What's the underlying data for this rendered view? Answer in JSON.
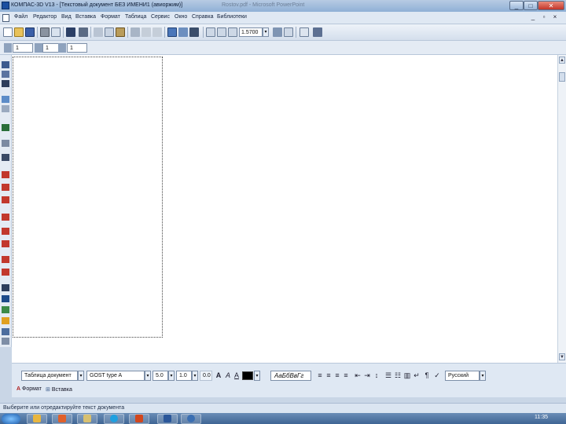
{
  "window": {
    "title": "КОМПАС-3D V13 - [Текстовый документ БЕЗ ИМЕНИ1 (авиоржим)]",
    "title_dim": "Rostov.pdf - Microsoft PowerPoint",
    "controls": [
      "_",
      "□",
      "✕"
    ]
  },
  "menu": {
    "items": [
      "Файл",
      "Редактор",
      "Вид",
      "Вставка",
      "Формат",
      "Таблица",
      "Сервис",
      "Окно",
      "Справка",
      "Библиотеки"
    ]
  },
  "toolbar": {
    "zoom_value": "1.5700",
    "zoom_arrow": "▾"
  },
  "toolbar2": {
    "field1": "1",
    "field2": "1",
    "field3": "1"
  },
  "format_panel": {
    "style_value": "Таблица документ",
    "font_value": "GOST type A",
    "size_value": "5.0",
    "scale_value": "1.0",
    "spacing_value": "0.0",
    "bold_glyph": "A",
    "italic_glyph": "A",
    "underline_glyph": "A",
    "sample_text": "АаБбВвГг",
    "language_value": "Русский",
    "tabs": [
      "Формат",
      "Вставка"
    ],
    "arrow": "▾"
  },
  "statusbar": {
    "text": "Выберите или отредактируйте текст документа"
  },
  "taskbar": {
    "clock": "11:35"
  },
  "colors": {
    "accent": "#1a4fa0",
    "close": "#c2362a"
  }
}
